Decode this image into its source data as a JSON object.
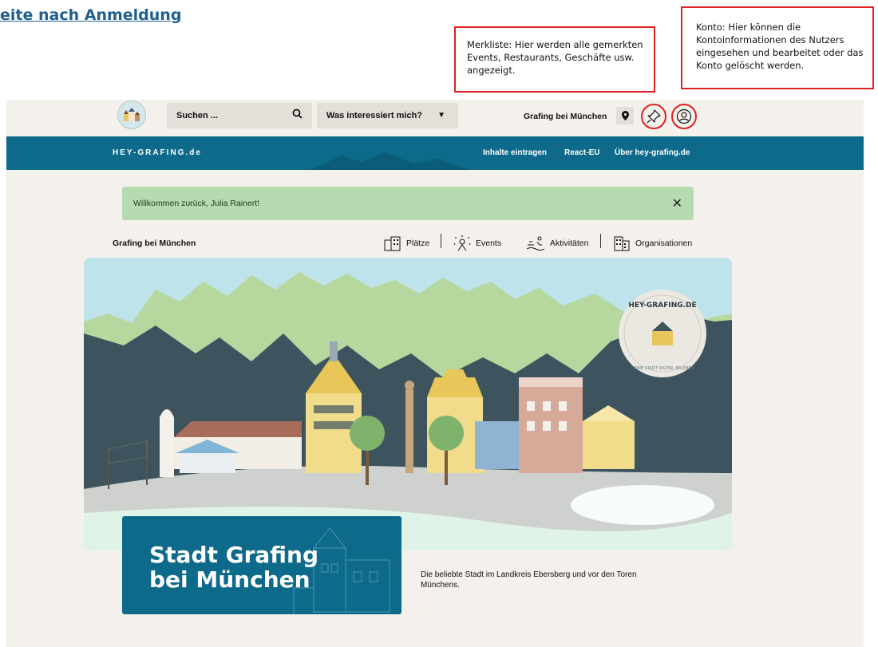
{
  "doc_heading": "eite nach Anmeldung",
  "callouts": {
    "merkliste": "Merkliste: Hier werden alle gemerkten Events, Restaurants, Geschäfte usw. angezeigt.",
    "konto": "Konto: Hier können die Kontoinformationen des Nutzers eingesehen und bearbeitet oder das Konto gelöscht werden."
  },
  "header": {
    "search_placeholder": "Suchen ...",
    "interest_select": "Was interessiert mich?",
    "location": "Grafing bei München"
  },
  "nav": {
    "brand": "HEY-GRAFING.de",
    "links": [
      "Inhalte eintragen",
      "React-EU",
      "Über hey-grafing.de"
    ]
  },
  "welcome": {
    "message": "Willkommen zurück, Julia Rainert!",
    "close": "✕"
  },
  "categories": {
    "city": "Grafing bei München",
    "items": [
      "Plätze",
      "Events",
      "Aktivitäten",
      "Organisationen"
    ]
  },
  "hero": {
    "badge_text": "HEY-GRAFING.DE",
    "badge_subtext": "DEINE STADT DIGITAL ERLEBEN"
  },
  "intro": {
    "title_line1": "Stadt Grafing",
    "title_line2": "bei München",
    "description": "Die beliebte Stadt im Landkreis Ebersberg und vor den Toren Münchens."
  },
  "colors": {
    "brand_blue": "#0d6a8a",
    "welcome_green": "#b7dbb0",
    "callout_red": "#e02020",
    "page_bg": "#f4f1ec"
  }
}
